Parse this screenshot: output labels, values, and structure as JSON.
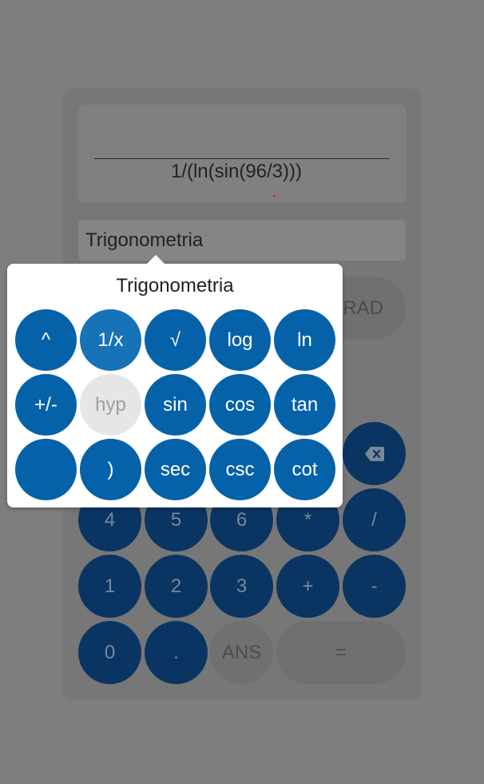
{
  "display": {
    "expression": "1/(ln(sin(96/3)))"
  },
  "selector": {
    "value": "Trigonometria"
  },
  "mode": {
    "label": "RAD"
  },
  "keypad": {
    "row1": {
      "backspace_icon": "backspace-icon"
    },
    "row2": [
      "4",
      "5",
      "6",
      "*",
      "/"
    ],
    "row3": [
      "1",
      "2",
      "3",
      "+",
      "-"
    ],
    "row4": [
      "0",
      ".",
      "ANS",
      "="
    ]
  },
  "popup": {
    "title": "Trigonometria",
    "row1": [
      "^",
      "1/x",
      "√",
      "log",
      "ln"
    ],
    "row2": [
      "+/-",
      "hyp",
      "sin",
      "cos",
      "tan"
    ],
    "row3": [
      "",
      ")",
      "sec",
      "csc",
      "cot"
    ]
  },
  "colors": {
    "popup_key": "#0562a8",
    "dimmed_key": "#0a3562",
    "overlay": "#7e7e7e"
  }
}
